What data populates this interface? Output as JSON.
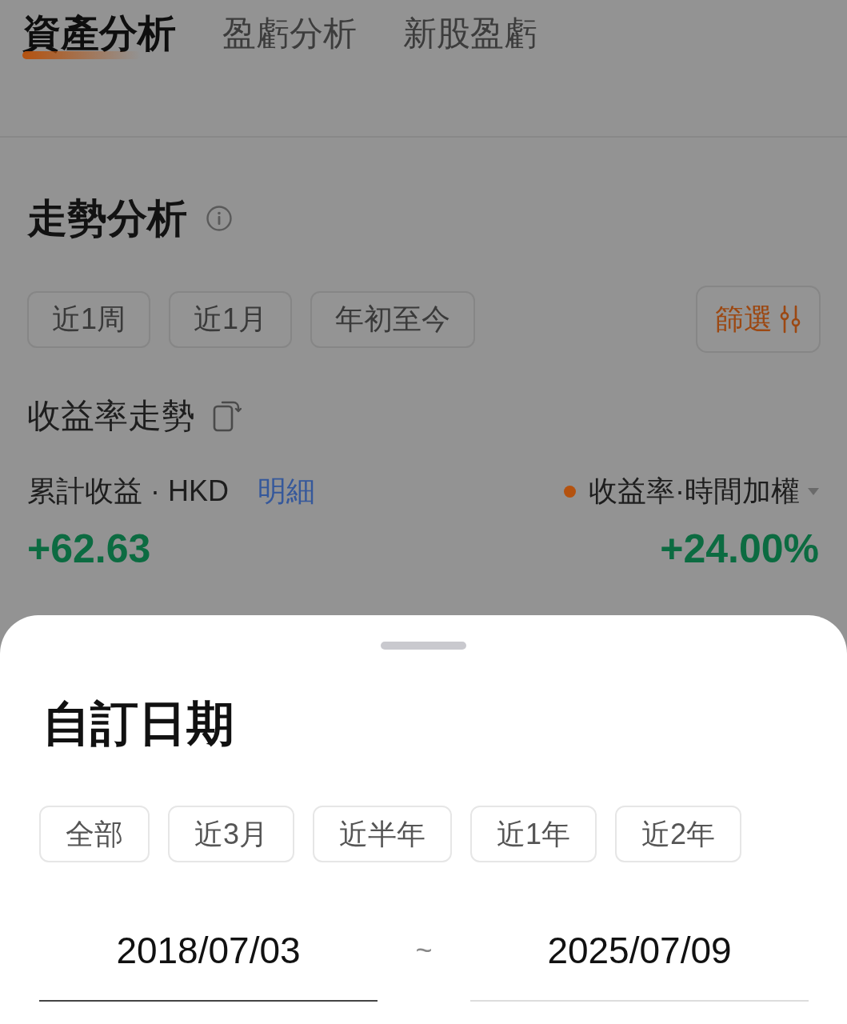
{
  "tabs": [
    {
      "label": "資產分析",
      "selected": true
    },
    {
      "label": "盈虧分析",
      "selected": false
    },
    {
      "label": "新股盈虧",
      "selected": false
    }
  ],
  "trend": {
    "title": "走勢分析",
    "periods": [
      {
        "label": "近1周",
        "selected": false
      },
      {
        "label": "近1月",
        "selected": false
      },
      {
        "label": "年初至今",
        "selected": false
      }
    ],
    "filter_button": {
      "label": "篩選"
    }
  },
  "returns": {
    "title": "收益率走勢",
    "cumulative": {
      "label": "累計收益 · HKD",
      "link": "明細",
      "value": "+62.63"
    },
    "rate": {
      "label": "收益率·時間加權",
      "value": "+24.00%"
    }
  },
  "sheet": {
    "title": "自訂日期",
    "presets": [
      {
        "label": "全部",
        "selected": false
      },
      {
        "label": "近3月",
        "selected": false
      },
      {
        "label": "近半年",
        "selected": false
      },
      {
        "label": "近1年",
        "selected": false
      },
      {
        "label": "近2年",
        "selected": false
      }
    ],
    "range": {
      "start": {
        "value": "2018/07/03",
        "selected": true
      },
      "separator": "~",
      "end": {
        "value": "2025/07/09",
        "selected": false
      }
    }
  }
}
